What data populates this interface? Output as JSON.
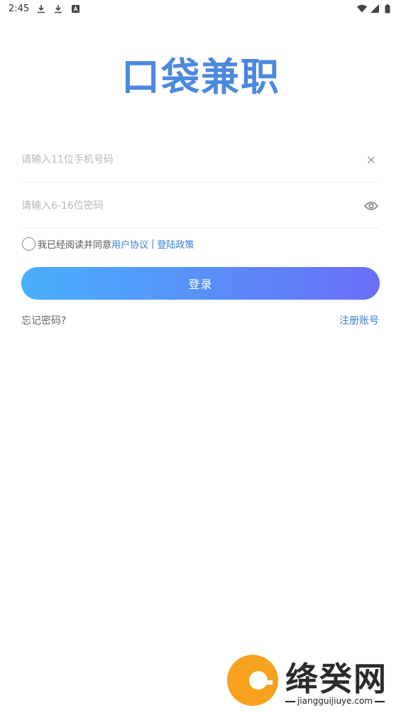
{
  "status_bar": {
    "time": "2:45",
    "icons_left": [
      "download-icon",
      "download-icon",
      "a-icon"
    ],
    "icons_right": [
      "wifi-icon",
      "signal-icon",
      "battery-icon"
    ]
  },
  "logo": {
    "text": "口袋兼职",
    "color": "#4c88e0"
  },
  "phone_field": {
    "placeholder": "请输入11位手机号码",
    "value": "",
    "clear_icon": "close-icon"
  },
  "password_field": {
    "placeholder": "请输入6-16位密码",
    "value": "",
    "toggle_icon": "eye-icon"
  },
  "agreement": {
    "prefix": "我已经阅读并同意",
    "user_agreement": "用户协议",
    "separator": "|",
    "login_policy": "登陆政策",
    "checked": false
  },
  "login_button": {
    "label": "登录"
  },
  "forgot_password": "忘记密码?",
  "register": "注册账号",
  "watermark": {
    "text": "绛癸网",
    "url": "jiangguijiuye.com"
  },
  "colors": {
    "accent": "#3a80d9",
    "gradient_start": "#48b0fb",
    "gradient_end": "#6b6ef9"
  }
}
